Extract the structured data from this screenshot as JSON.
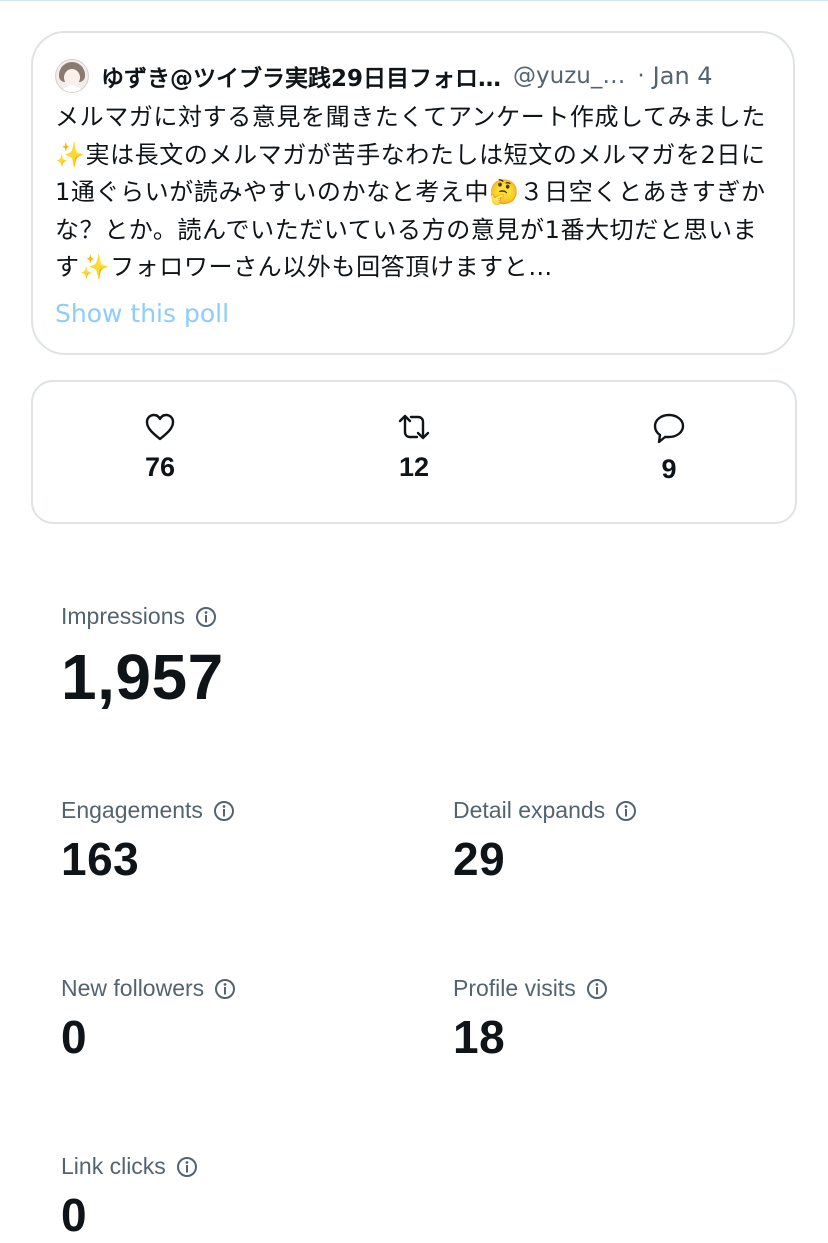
{
  "tweet": {
    "display_name": "ゆずき@ツイブラ実践29日目フォロ…",
    "handle": "@yuzu_…",
    "separator": "·",
    "date": "Jan 4",
    "text": "メルマガに対する意見を聞きたくてアンケート作成してみました✨実は長文のメルマガが苦手なわたしは短文のメルマガを2日に1通ぐらいが読みやすいのかなと考え中🤔３日空くとあきすぎかな？とか。読んでいただいている方の意見が1番大切だと思います✨フォロワーさん以外も回答頂けますと…",
    "show_poll_label": "Show this poll"
  },
  "actions": {
    "likes": "76",
    "retweets": "12",
    "replies": "9"
  },
  "metrics": {
    "impressions": {
      "label": "Impressions",
      "value": "1,957"
    },
    "engagements": {
      "label": "Engagements",
      "value": "163"
    },
    "detail_expands": {
      "label": "Detail expands",
      "value": "29"
    },
    "new_followers": {
      "label": "New followers",
      "value": "0"
    },
    "profile_visits": {
      "label": "Profile visits",
      "value": "18"
    },
    "link_clicks": {
      "label": "Link clicks",
      "value": "0"
    }
  },
  "colors": {
    "text_primary": "#0f1419",
    "text_secondary": "#536471",
    "link_faded": "#8ecdf7",
    "border": "#dfe3e6"
  },
  "icons": {
    "like": "heart-icon",
    "retweet": "retweet-icon",
    "reply": "reply-icon",
    "info": "info-icon"
  }
}
